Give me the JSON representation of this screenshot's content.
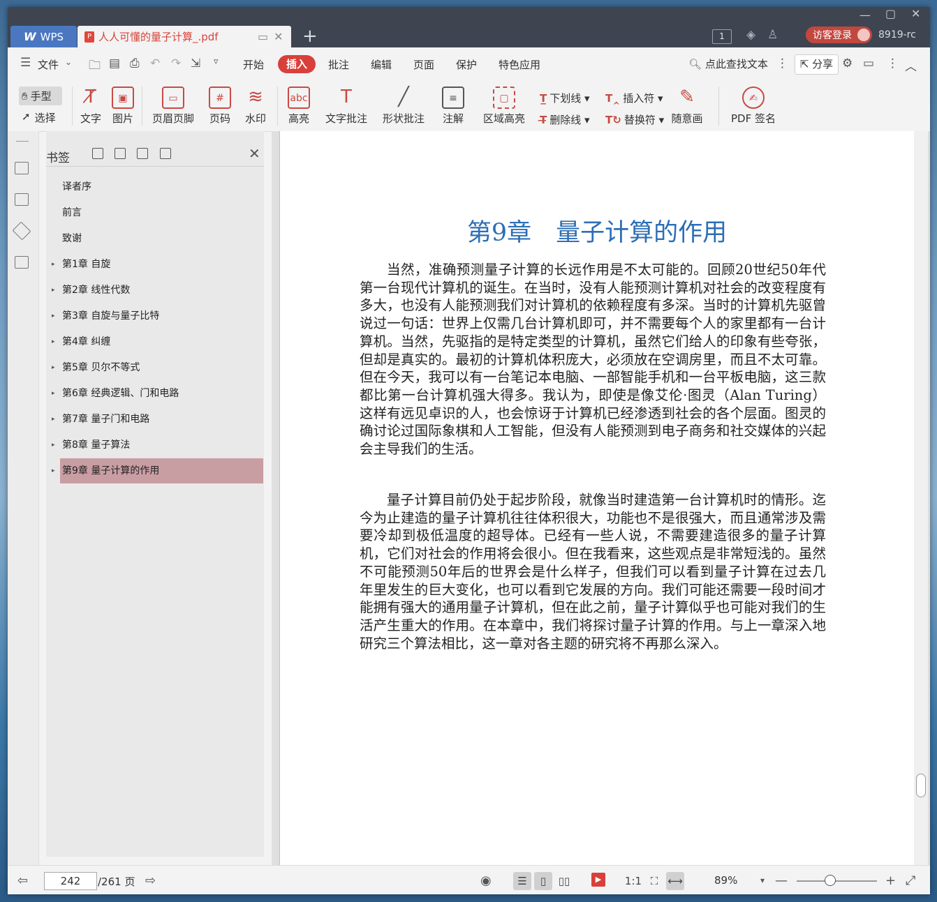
{
  "app": {
    "name": "WPS",
    "document_tab_title": "人人可懂的量子计算_.pdf",
    "page_badge": "1",
    "login_label": "访客登录",
    "user_text": "8919-rc"
  },
  "menu": {
    "file": "文件",
    "tabs": [
      "开始",
      "插入",
      "批注",
      "编辑",
      "页面",
      "保护",
      "特色应用"
    ],
    "active_tab": "插入",
    "search_label": "点此查找文本",
    "share_label": "分享"
  },
  "ribbon": {
    "hand": "手型",
    "select": "选择",
    "buttons": [
      "文字",
      "图片",
      "页眉页脚",
      "页码",
      "水印",
      "高亮",
      "文字批注",
      "形状批注",
      "注解",
      "区域高亮"
    ],
    "underline": "下划线",
    "insert_mark": "插入符",
    "strikethrough": "删除线",
    "replace_mark": "替换符",
    "freehand": "随意画",
    "pdf_sign": "PDF 签名"
  },
  "bookmarks": {
    "title": "书签",
    "items": [
      {
        "label": "译者序"
      },
      {
        "label": "前言"
      },
      {
        "label": "致谢"
      },
      {
        "label": "第1章 自旋"
      },
      {
        "label": "第2章 线性代数"
      },
      {
        "label": "第3章 自旋与量子比特"
      },
      {
        "label": "第4章 纠缠"
      },
      {
        "label": "第5章 贝尔不等式"
      },
      {
        "label": "第6章 经典逻辑、门和电路"
      },
      {
        "label": "第7章 量子门和电路"
      },
      {
        "label": "第8章 量子算法"
      },
      {
        "label": "第9章 量子计算的作用"
      }
    ],
    "active": "第9章 量子计算的作用"
  },
  "page": {
    "chapter_title": "第9章　量子计算的作用",
    "paragraphs": [
      "当然，准确预测量子计算的长远作用是不太可能的。回顾20世纪50年代第一台现代计算机的诞生。在当时，没有人能预测计算机对社会的改变程度有多大，也没有人能预测我们对计算机的依赖程度有多深。当时的计算机先驱曾说过一句话：世界上仅需几台计算机即可，并不需要每个人的家里都有一台计算机。当然，先驱指的是特定类型的计算机，虽然它们给人的印象有些夸张，但却是真实的。最初的计算机体积庞大，必须放在空调房里，而且不太可靠。但在今天，我可以有一台笔记本电脑、一部智能手机和一台平板电脑，这三款都比第一台计算机强大得多。我认为，即使是像艾伦·图灵（Alan Turing）这样有远见卓识的人，也会惊讶于计算机已经渗透到社会的各个层面。图灵的确讨论过国际象棋和人工智能，但没有人能预测到电子商务和社交媒体的兴起会主导我们的生活。",
      "量子计算目前仍处于起步阶段，就像当时建造第一台计算机时的情形。迄今为止建造的量子计算机往往体积很大，功能也不是很强大，而且通常涉及需要冷却到极低温度的超导体。已经有一些人说，不需要建造很多的量子计算机，它们对社会的作用将会很小。但在我看来，这些观点是非常短浅的。虽然不可能预测50年后的世界会是什么样子，但我们可以看到量子计算在过去几年里发生的巨大变化，也可以看到它发展的方向。我们可能还需要一段时间才能拥有强大的通用量子计算机，但在此之前，量子计算似乎也可能对我们的生活产生重大的作用。在本章中，我们将探讨量子计算的作用。与上一章深入地研究三个算法相比，这一章对各主题的研究将不再那么深入。"
    ]
  },
  "status": {
    "current_page": "242",
    "total_pages": "/261 页",
    "zoom": "89%"
  }
}
